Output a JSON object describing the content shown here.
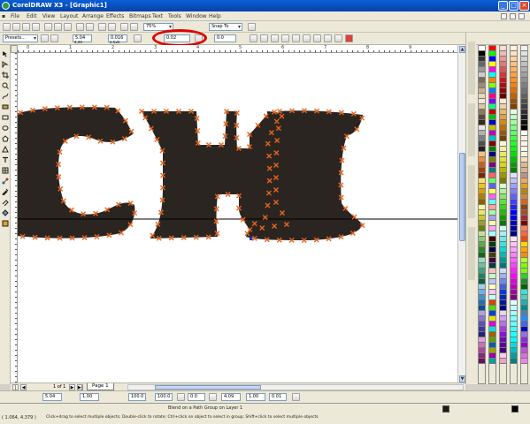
{
  "window": {
    "title": "CorelDRAW X3 - [Graphic1]",
    "controls": [
      "_",
      "□",
      "×"
    ]
  },
  "menu": {
    "items": [
      "File",
      "Edit",
      "View",
      "Layout",
      "Arrange",
      "Effects",
      "Bitmaps",
      "Text",
      "Tools",
      "Window",
      "Help"
    ]
  },
  "standard_toolbar": {
    "zoom": "75%",
    "snap_dropdown": "Snap To"
  },
  "property_bar": {
    "preset": "Presets...",
    "x": "5.04",
    "y": "4.09",
    "width": "0.016",
    "height": "0.020",
    "highlighted_value": "0.02",
    "steps": "20",
    "angle": "0.0"
  },
  "ruler": {
    "top_labels": [
      "0",
      "1",
      "2",
      "3",
      "4",
      "5",
      "6",
      "7",
      "8",
      "9"
    ],
    "units": "inches"
  },
  "canvas": {
    "artwork_text": "CHI",
    "fill_color": "#2a2520",
    "node_color": "#e8641e",
    "guide_color": "#000000"
  },
  "page_nav": {
    "count": "1 of 1",
    "tab": "Page 1"
  },
  "transform_bar": {
    "x": "5.04",
    "y": "4.09",
    "w": "1.00",
    "h": "1.00",
    "scale_w": "100.0",
    "scale_h": "100.0",
    "angle": "0.0",
    "nudge": "0.01"
  },
  "status": {
    "object_info": "Blend on a Path Group on Layer 1",
    "hint": "Click+drag to select multiple objects; Double-click to rotate; Ctrl+click on object to select in group; Shift+click to select multiple objects",
    "coords": "( 1.064, 4.379 )",
    "fill_color": "#1f1a16",
    "outline_color": "#000000"
  },
  "palette": {
    "columns": [
      [
        "#ffffff",
        "#000000",
        "#333333",
        "#666666",
        "#999999",
        "#cccccc",
        "#7a6a58",
        "#a08a70",
        "#c8b090",
        "#e8d8b8",
        "#f0e8d0",
        "#d8c8a0",
        "#8a7a5a",
        "#5a4a38",
        "#382818",
        "#e6e6e6",
        "#b0b0b0",
        "#808080",
        "#505050",
        "#202020",
        "#f4c080",
        "#e89040",
        "#c86020",
        "#a04010",
        "#782808",
        "#f8e060",
        "#f0c020",
        "#d8a000",
        "#b08000",
        "#886000",
        "#f8f8a0",
        "#e8e860",
        "#c8c830",
        "#98a020",
        "#688010",
        "#c0e0a0",
        "#90c870",
        "#60a848",
        "#308828",
        "#106818",
        "#a0d8c0",
        "#70c0a0",
        "#40a080",
        "#208060",
        "#086040",
        "#a0d0f0",
        "#70b0e0",
        "#4090d0",
        "#2070b0",
        "#085090",
        "#b0a0e0",
        "#8878c8",
        "#6050b0",
        "#403898",
        "#202080",
        "#e0a0d0",
        "#c870b8",
        "#a84898",
        "#882878",
        "#681058"
      ],
      [
        "#ff0000",
        "#00ff00",
        "#0000ff",
        "#ffff00",
        "#ff00ff",
        "#00ffff",
        "#ff8000",
        "#80ff00",
        "#0080ff",
        "#ff0080",
        "#8000ff",
        "#00ff80",
        "#c00000",
        "#00c000",
        "#0000c0",
        "#c0c000",
        "#c000c0",
        "#00c0c0",
        "#800000",
        "#008000",
        "#000080",
        "#808000",
        "#800080",
        "#008080",
        "#ff6060",
        "#60ff60",
        "#6060ff",
        "#ffff60",
        "#ff60ff",
        "#60ffff",
        "#ffa0a0",
        "#a0ffa0",
        "#a0a0ff",
        "#ffffa0",
        "#ffa0ff",
        "#a0ffff",
        "#400000",
        "#004000",
        "#000040",
        "#404000",
        "#400040",
        "#004040",
        "#ffc0c0",
        "#c0ffc0",
        "#c0c0ff",
        "#ffffc0",
        "#ffc0ff",
        "#c0ffff",
        "#e04000",
        "#40e000",
        "#0040e0",
        "#e0e000",
        "#e000e0",
        "#00e0e0",
        "#a06000",
        "#60a000",
        "#0060a0",
        "#a0a000",
        "#a000a0",
        "#00a0a0"
      ],
      [
        "#f8d8d8",
        "#f0b8b8",
        "#e89898",
        "#e07878",
        "#d85858",
        "#d03838",
        "#c81818",
        "#a81010",
        "#880808",
        "#680000",
        "#f8e8d0",
        "#f0d0a0",
        "#e8b870",
        "#e0a040",
        "#d88810",
        "#b87008",
        "#985800",
        "#784000",
        "#f8f8d0",
        "#f0f0a0",
        "#e8e870",
        "#e0e040",
        "#d8d810",
        "#b8b808",
        "#989800",
        "#787800",
        "#d8f8d0",
        "#b0f0a0",
        "#88e870",
        "#60e040",
        "#38d810",
        "#28b808",
        "#189800",
        "#087800",
        "#d0f8f8",
        "#a0f0f0",
        "#70e8e8",
        "#40e0e0",
        "#10d8d8",
        "#08b8b8",
        "#009898",
        "#007878",
        "#d0d8f8",
        "#a0b0f0",
        "#7088e8",
        "#4060e0",
        "#1038d8",
        "#0828b8",
        "#001898",
        "#000878",
        "#e8d0f8",
        "#d0a0f0",
        "#b870e8",
        "#a040e0",
        "#8810d8",
        "#7008b8",
        "#580098",
        "#400078",
        "#f8d0e8",
        "#f0a0d0"
      ],
      [
        "#fff0e0",
        "#ffe0c0",
        "#ffd0a0",
        "#ffc080",
        "#ffb060",
        "#ffa040",
        "#ff9020",
        "#ff8000",
        "#e07000",
        "#c06000",
        "#a05000",
        "#804000",
        "#e0ffe0",
        "#c0ffc0",
        "#a0ffa0",
        "#80ff80",
        "#60ff60",
        "#40ff40",
        "#20ff20",
        "#00ff00",
        "#00e000",
        "#00c000",
        "#00a000",
        "#008000",
        "#e0e0ff",
        "#c0c0ff",
        "#a0a0ff",
        "#8080ff",
        "#6060ff",
        "#4040ff",
        "#2020ff",
        "#0000ff",
        "#0000e0",
        "#0000c0",
        "#0000a0",
        "#000080",
        "#ffe0ff",
        "#ffc0ff",
        "#ffa0ff",
        "#ff80ff",
        "#ff60ff",
        "#ff40ff",
        "#ff20ff",
        "#ff00ff",
        "#e000e0",
        "#c000c0",
        "#a000a0",
        "#800080",
        "#e0ffff",
        "#c0ffff",
        "#a0ffff",
        "#80ffff",
        "#60ffff",
        "#40ffff",
        "#20ffff",
        "#00ffff",
        "#00e0e0",
        "#00c0c0",
        "#00a0a0",
        "#008080"
      ],
      [
        "#f0f0f0",
        "#e0e0e0",
        "#d0d0d0",
        "#c0c0c0",
        "#b0b0b0",
        "#a0a0a0",
        "#909090",
        "#808080",
        "#707070",
        "#606060",
        "#505050",
        "#404040",
        "#303030",
        "#202020",
        "#101010",
        "#000000",
        "#fffaf0",
        "#faf0e6",
        "#fdf5e6",
        "#fff5ee",
        "#f5f5dc",
        "#f5deb3",
        "#deb887",
        "#d2b48c",
        "#bc8f8f",
        "#f4a460",
        "#daa520",
        "#b8860b",
        "#cd853f",
        "#d2691e",
        "#8b4513",
        "#a0522d",
        "#a52a2a",
        "#800000",
        "#ff7f50",
        "#ff6347",
        "#ff4500",
        "#ffd700",
        "#ffa500",
        "#ff8c00",
        "#adff2f",
        "#7fff00",
        "#7cfc00",
        "#32cd32",
        "#228b22",
        "#006400",
        "#40e0d0",
        "#48d1cc",
        "#20b2aa",
        "#008b8b",
        "#4682b4",
        "#1e90ff",
        "#4169e1",
        "#0000cd",
        "#9370db",
        "#8a2be2",
        "#9400d3",
        "#ba55d3",
        "#da70d6",
        "#ee82ee"
      ]
    ]
  }
}
